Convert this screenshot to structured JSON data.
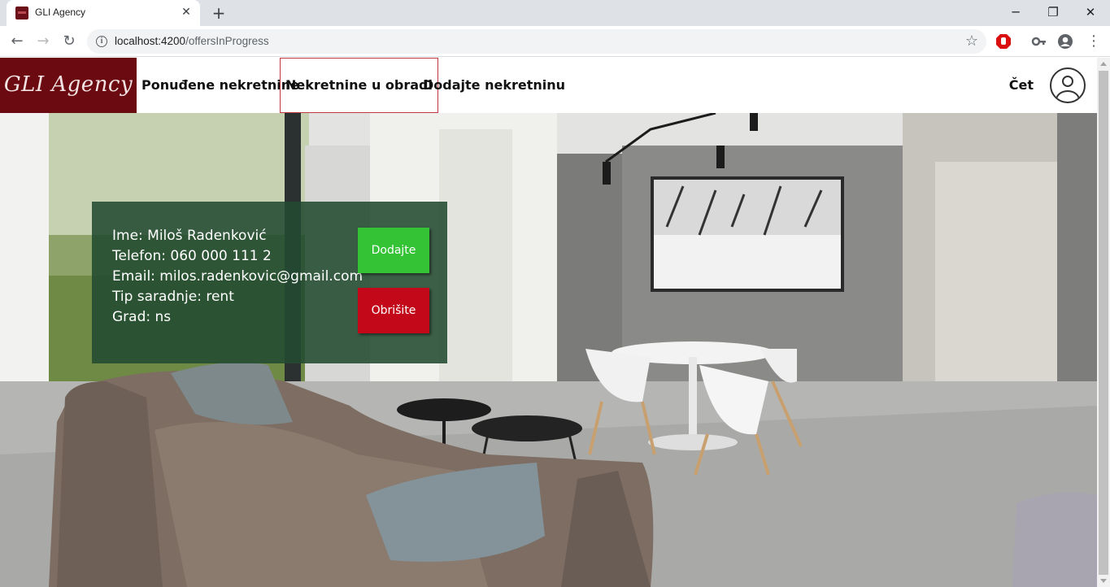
{
  "browser": {
    "tab_title": "GLI Agency",
    "url_host": "localhost:4200",
    "url_path": "/offersInProgress"
  },
  "navbar": {
    "brand": "GLI Agency",
    "links": [
      {
        "label": "Ponuđene nekretnine"
      },
      {
        "label": "Nekretnine u obradi"
      },
      {
        "label": "Dodajte nekretninu"
      }
    ],
    "user": "Čet"
  },
  "card": {
    "lines": [
      "Ime: Miloš Radenković",
      "Telefon: 060 000 111 2",
      "Email: milos.radenkovic@gmail.com",
      "Tip saradnje: rent",
      "Grad: ns"
    ],
    "add_label": "Dodajte",
    "delete_label": "Obrišite",
    "colors": {
      "add": "#33c335",
      "delete": "#c3081a"
    }
  }
}
